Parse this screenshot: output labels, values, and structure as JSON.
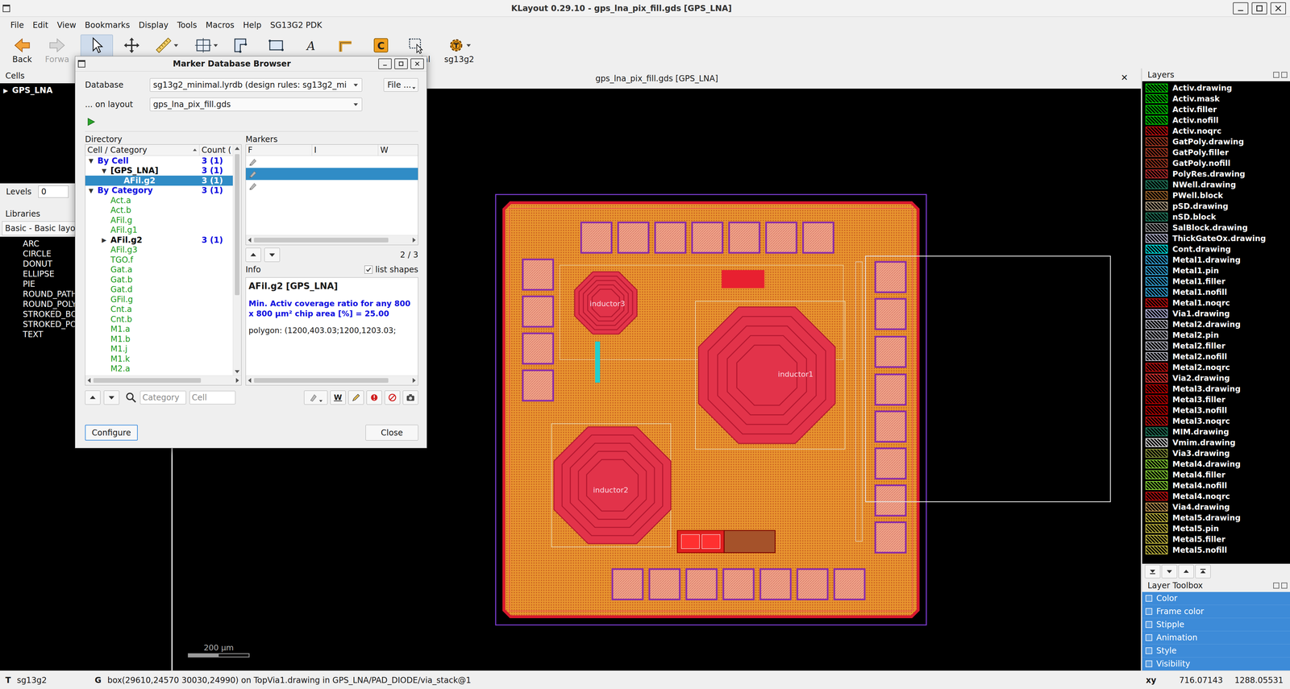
{
  "window": {
    "title": "KLayout 0.29.10 - gps_lna_pix_fill.gds [GPS_LNA]"
  },
  "menu": [
    "File",
    "Edit",
    "View",
    "Bookmarks",
    "Display",
    "Tools",
    "Macros",
    "Help",
    "SG13G2 PDK"
  ],
  "toolbar": [
    {
      "kind": "back",
      "label": "Back",
      "selected": false,
      "disabled": false,
      "dropdown": false
    },
    {
      "kind": "forward",
      "label": "Forwa",
      "selected": false,
      "disabled": true,
      "dropdown": false
    },
    {
      "kind": "select",
      "selected": true,
      "disabled": false,
      "dropdown": false
    },
    {
      "kind": "move",
      "selected": false,
      "disabled": false,
      "dropdown": false
    },
    {
      "kind": "ruler",
      "selected": false,
      "disabled": false,
      "dropdown": true
    },
    {
      "kind": "instbox",
      "selected": false,
      "disabled": false,
      "dropdown": true
    },
    {
      "kind": "polygon",
      "selected": false,
      "disabled": false,
      "dropdown": false
    },
    {
      "kind": "box",
      "selected": false,
      "disabled": false,
      "dropdown": false
    },
    {
      "kind": "text",
      "glyph": "A",
      "selected": false,
      "disabled": false,
      "dropdown": false
    },
    {
      "kind": "path",
      "selected": false,
      "disabled": false,
      "dropdown": false
    },
    {
      "kind": "cell",
      "glyph": "C",
      "selected": false,
      "disabled": false,
      "dropdown": false
    },
    {
      "kind": "partial",
      "label": "ial",
      "selected": false,
      "disabled": false,
      "dropdown": false
    },
    {
      "kind": "tech",
      "label": "sg13g2",
      "selected": false,
      "disabled": false,
      "dropdown": true
    }
  ],
  "cells": {
    "title": "Cells",
    "items": [
      {
        "label": "GPS_LNA",
        "arrow": "▶",
        "expanded": false,
        "selected": false
      }
    ]
  },
  "levels": {
    "label": "Levels",
    "value": "0"
  },
  "libraries": {
    "title": "Libraries",
    "selector": "Basic - Basic layo",
    "items": [
      "ARC",
      "CIRCLE",
      "DONUT",
      "ELLIPSE",
      "PIE",
      "ROUND_PATH",
      "ROUND_POLY",
      "STROKED_BO",
      "STROKED_PO",
      "TEXT"
    ]
  },
  "view": {
    "title": "gps_lna_pix_fill.gds [GPS_LNA]",
    "close": "✕",
    "labels": [
      "inductor3",
      "inductor1",
      "inductor2"
    ],
    "scale": "200 µm"
  },
  "layers": {
    "title": "Layers",
    "items": [
      {
        "name": "Activ.drawing",
        "color": "#00e000"
      },
      {
        "name": "Activ.mask",
        "color": "#00e000"
      },
      {
        "name": "Activ.filler",
        "color": "#00e000"
      },
      {
        "name": "Activ.nofill",
        "color": "#00e000"
      },
      {
        "name": "Activ.noqrc",
        "color": "#e01010"
      },
      {
        "name": "GatPoly.drawing",
        "color": "#bf4026"
      },
      {
        "name": "GatPoly.filler",
        "color": "#bf4026"
      },
      {
        "name": "GatPoly.nofill",
        "color": "#bf4026"
      },
      {
        "name": "PolyRes.drawing",
        "color": "#d03030"
      },
      {
        "name": "NWell.drawing",
        "color": "#268c6b"
      },
      {
        "name": "PWell.block",
        "color": "#b07030"
      },
      {
        "name": "pSD.drawing",
        "color": "#ccb899"
      },
      {
        "name": "nSD.block",
        "color": "#268c6b"
      },
      {
        "name": "SalBlock.drawing",
        "color": "#a6a6a6"
      },
      {
        "name": "ThickGateOx.drawing",
        "color": "#d0d0f0"
      },
      {
        "name": "Cont.drawing",
        "color": "#00ffff"
      },
      {
        "name": "Metal1.drawing",
        "color": "#39bfff"
      },
      {
        "name": "Metal1.pin",
        "color": "#39bfff"
      },
      {
        "name": "Metal1.filler",
        "color": "#39bfff"
      },
      {
        "name": "Metal1.nofill",
        "color": "#39bfff"
      },
      {
        "name": "Metal1.noqrc",
        "color": "#e01010"
      },
      {
        "name": "Via1.drawing",
        "color": "#ccccff"
      },
      {
        "name": "Metal2.drawing",
        "color": "#ccccd9"
      },
      {
        "name": "Metal2.pin",
        "color": "#ccccd9"
      },
      {
        "name": "Metal2.filler",
        "color": "#ccccd9"
      },
      {
        "name": "Metal2.nofill",
        "color": "#ccccd9"
      },
      {
        "name": "Metal2.noqrc",
        "color": "#e01010"
      },
      {
        "name": "Via2.drawing",
        "color": "#ff3736"
      },
      {
        "name": "Metal3.drawing",
        "color": "#d80000"
      },
      {
        "name": "Metal3.filler",
        "color": "#d80000"
      },
      {
        "name": "Metal3.nofill",
        "color": "#d80000"
      },
      {
        "name": "Metal3.noqrc",
        "color": "#e01010"
      },
      {
        "name": "MIM.drawing",
        "color": "#268c6b"
      },
      {
        "name": "Vmim.drawing",
        "color": "#ffffff"
      },
      {
        "name": "Via3.drawing",
        "color": "#9ba940"
      },
      {
        "name": "Metal4.drawing",
        "color": "#93e837"
      },
      {
        "name": "Metal4.filler",
        "color": "#93e837"
      },
      {
        "name": "Metal4.nofill",
        "color": "#93e837"
      },
      {
        "name": "Metal4.noqrc",
        "color": "#e01010"
      },
      {
        "name": "Via4.drawing",
        "color": "#deac5e"
      },
      {
        "name": "Metal5.drawing",
        "color": "#dcd146"
      },
      {
        "name": "Metal5.pin",
        "color": "#dcd146"
      },
      {
        "name": "Metal5.filler",
        "color": "#dcd146"
      },
      {
        "name": "Metal5.nofill",
        "color": "#dcd146"
      }
    ]
  },
  "toolbox": {
    "title": "Layer Toolbox",
    "items": [
      {
        "label": "Color",
        "checked": false
      },
      {
        "label": "Frame color",
        "checked": false
      },
      {
        "label": "Stipple",
        "checked": false
      },
      {
        "label": "Animation",
        "checked": false
      },
      {
        "label": "Style",
        "checked": false
      },
      {
        "label": "Visibility",
        "checked": false
      }
    ]
  },
  "dialog": {
    "title": "Marker Database Browser",
    "database": {
      "label": "Database",
      "value": "sg13g2_minimal.lyrdb (design rules: sg13g2_mi",
      "file_button": "File ..."
    },
    "layout": {
      "label": "... on layout",
      "value": "gps_lna_pix_fill.gds"
    },
    "directory": {
      "title": "Directory",
      "columns": [
        "Cell / Category",
        "Count ("
      ],
      "rows": [
        {
          "label": "By Cell",
          "count": "3 (1)",
          "level": 0,
          "arrow": "▼",
          "expanded": true,
          "selected": false,
          "kind": "group"
        },
        {
          "label": "[GPS_LNA]",
          "count": "3 (1)",
          "level": 1,
          "arrow": "▼",
          "expanded": true,
          "selected": false,
          "kind": "cell"
        },
        {
          "label": "AFil.g2",
          "count": "3 (1)",
          "level": 2,
          "selected": true,
          "kind": "hit"
        },
        {
          "label": "By Category",
          "count": "3 (1)",
          "level": 0,
          "arrow": "▼",
          "expanded": true,
          "selected": false,
          "kind": "group"
        },
        {
          "label": "Act.a",
          "level": 1,
          "selected": false,
          "kind": "empty"
        },
        {
          "label": "Act.b",
          "level": 1,
          "selected": false,
          "kind": "empty"
        },
        {
          "label": "AFil.g",
          "level": 1,
          "selected": false,
          "kind": "empty"
        },
        {
          "label": "AFil.g1",
          "level": 1,
          "selected": false,
          "kind": "empty"
        },
        {
          "label": "AFil.g2",
          "count": "3 (1)",
          "level": 1,
          "arrow": "▶",
          "expanded": false,
          "selected": false,
          "kind": "hit"
        },
        {
          "label": "AFil.g3",
          "level": 1,
          "selected": false,
          "kind": "empty"
        },
        {
          "label": "TGO.f",
          "level": 1,
          "selected": false,
          "kind": "empty"
        },
        {
          "label": "Gat.a",
          "level": 1,
          "selected": false,
          "kind": "empty"
        },
        {
          "label": "Gat.b",
          "level": 1,
          "selected": false,
          "kind": "empty"
        },
        {
          "label": "Gat.d",
          "level": 1,
          "selected": false,
          "kind": "empty"
        },
        {
          "label": "GFil.g",
          "level": 1,
          "selected": false,
          "kind": "empty"
        },
        {
          "label": "Cnt.a",
          "level": 1,
          "selected": false,
          "kind": "empty"
        },
        {
          "label": "Cnt.b",
          "level": 1,
          "selected": false,
          "kind": "empty"
        },
        {
          "label": "M1.a",
          "level": 1,
          "selected": false,
          "kind": "empty"
        },
        {
          "label": "M1.b",
          "level": 1,
          "selected": false,
          "kind": "empty"
        },
        {
          "label": "M1.j",
          "level": 1,
          "selected": false,
          "kind": "empty"
        },
        {
          "label": "M1.k",
          "level": 1,
          "selected": false,
          "kind": "empty"
        },
        {
          "label": "M2.a",
          "level": 1,
          "selected": false,
          "kind": "empty"
        }
      ]
    },
    "markers": {
      "title": "Markers",
      "columns": [
        "F",
        "I",
        "W"
      ],
      "rows": [
        {
          "selected": false
        },
        {
          "selected": true
        },
        {
          "selected": false
        }
      ],
      "position": "2 / 3"
    },
    "info": {
      "title": "Info",
      "list_shapes": {
        "label": "list shapes",
        "checked": true
      },
      "heading": "AFil.g2 [GPS_LNA]",
      "description": "Min. Activ coverage ratio for any 800 x 800 µm² chip area [%] = 25.00",
      "shape": "polygon: (1200,403.03;1200,1203.03;"
    },
    "filters": [
      {
        "name": "category-filter",
        "placeholder": "Category"
      },
      {
        "name": "cell-filter",
        "placeholder": "Cell"
      }
    ],
    "marker_tools": [
      {
        "kind": "flag"
      },
      {
        "kind": "waive",
        "label": "W"
      },
      {
        "kind": "edit"
      },
      {
        "kind": "important"
      },
      {
        "kind": "remove"
      },
      {
        "kind": "snapshot"
      }
    ],
    "buttons": {
      "configure": "Configure",
      "close": "Close"
    }
  },
  "status_bar": {
    "tech_tag": "T",
    "tech": "sg13g2",
    "msg_tag": "G",
    "message": "box(29610,24570 30030,24990) on TopVia1.drawing in GPS_LNA/PAD_DIODE/via_stack@1",
    "coord_label": "xy",
    "x": "716.07143",
    "y": "1288.05531"
  }
}
